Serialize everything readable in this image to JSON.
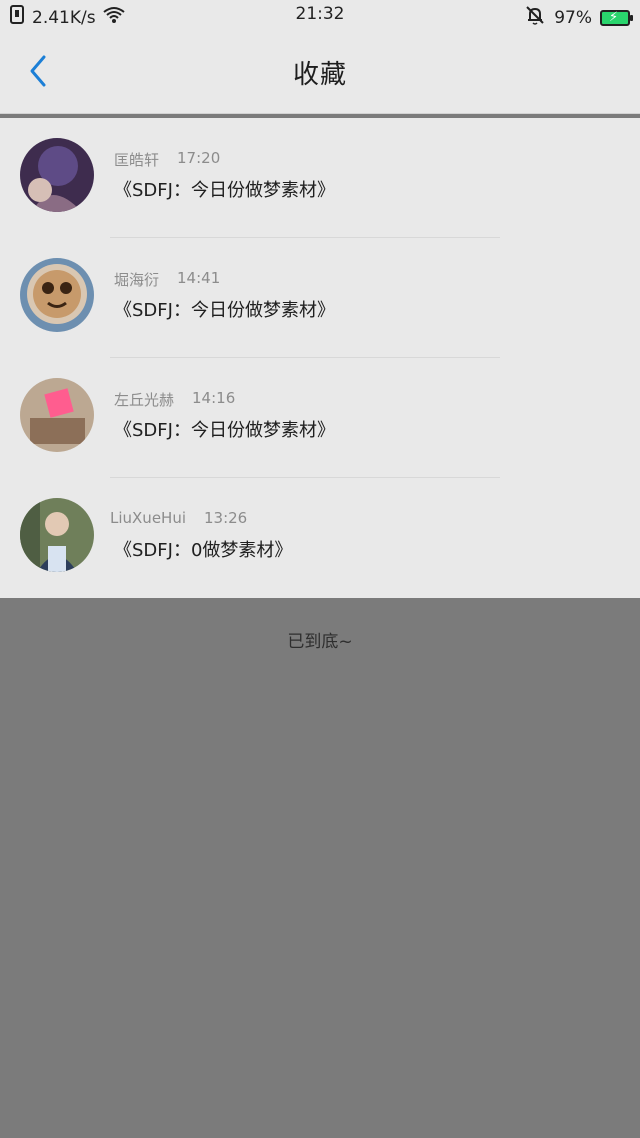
{
  "status_bar": {
    "speed": "2.41K/s",
    "time": "21:32",
    "battery": "97%"
  },
  "nav": {
    "title": "收藏",
    "back_icon": "chevron-left-icon",
    "accent_color": "#1c7fd6"
  },
  "items": [
    {
      "name": "匡皓轩",
      "time": "17:20",
      "message": "《SDFJ：今日份做梦素材》"
    },
    {
      "name": "堀海衍",
      "time": "14:41",
      "message": "《SDFJ：今日份做梦素材》"
    },
    {
      "name": "左丘光赫",
      "time": "14:16",
      "message": "《SDFJ：今日份做梦素材》"
    },
    {
      "name": "LiuXueHui",
      "time": "13:26",
      "message": "《SDFJ：0做梦素材》"
    }
  ],
  "footer": {
    "end_text": "已到底~"
  }
}
